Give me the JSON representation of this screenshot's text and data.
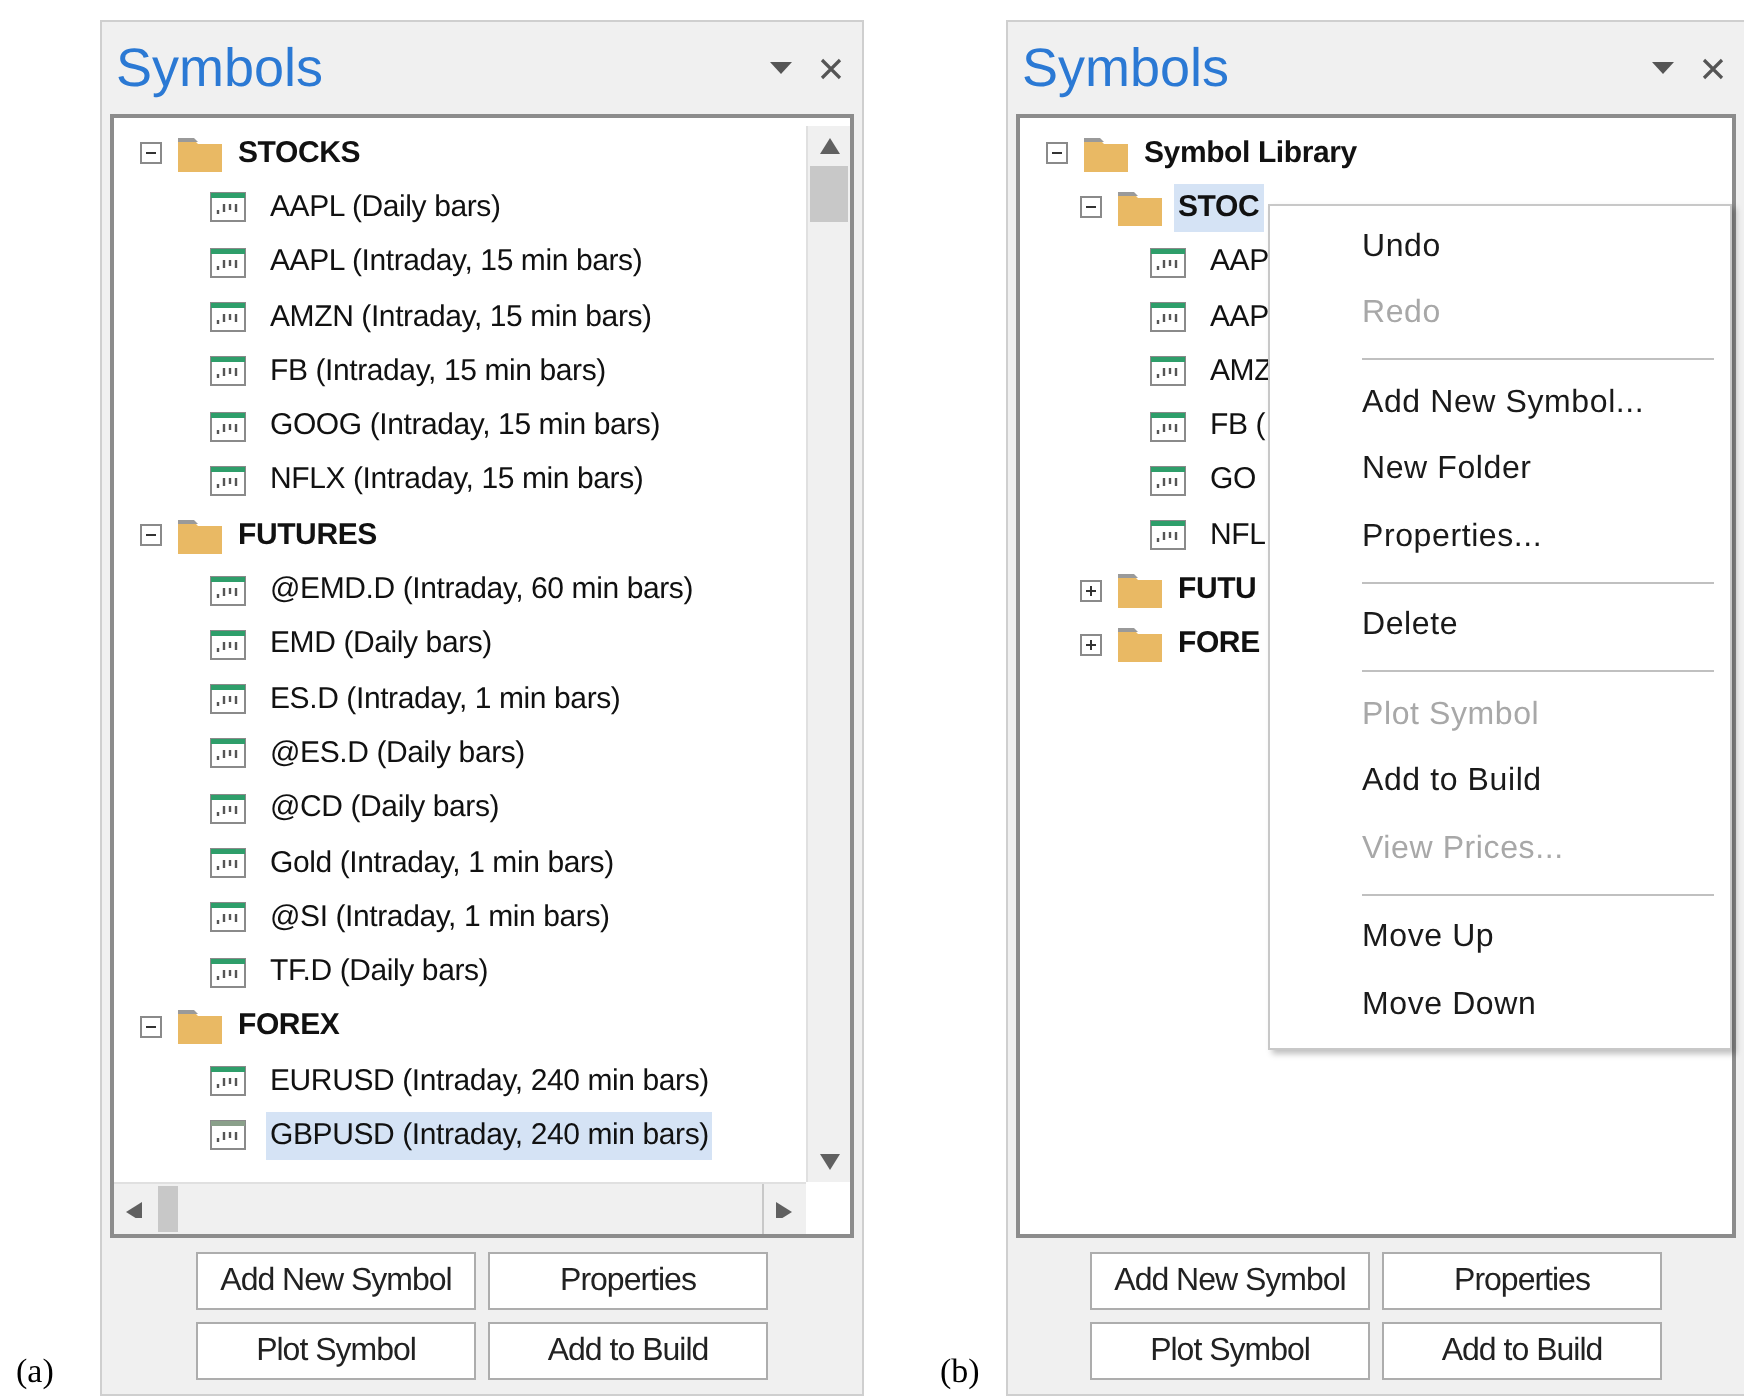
{
  "panels": [
    {
      "caption": "(a)",
      "title": "Symbols",
      "scrollbars": true,
      "tree": [
        {
          "kind": "folder",
          "label": "STOCKS",
          "expanded": true,
          "selected": false,
          "children": [
            {
              "kind": "symbol",
              "label": "AAPL (Daily bars)",
              "selected": false
            },
            {
              "kind": "symbol",
              "label": "AAPL (Intraday, 15 min bars)",
              "selected": false
            },
            {
              "kind": "symbol",
              "label": "AMZN (Intraday, 15 min bars)",
              "selected": false
            },
            {
              "kind": "symbol",
              "label": "FB (Intraday, 15 min bars)",
              "selected": false
            },
            {
              "kind": "symbol",
              "label": "GOOG (Intraday, 15 min bars)",
              "selected": false
            },
            {
              "kind": "symbol",
              "label": "NFLX (Intraday, 15 min bars)",
              "selected": false
            }
          ]
        },
        {
          "kind": "folder",
          "label": "FUTURES",
          "expanded": true,
          "selected": false,
          "children": [
            {
              "kind": "symbol",
              "label": "@EMD.D (Intraday, 60 min bars)",
              "selected": false
            },
            {
              "kind": "symbol",
              "label": "EMD (Daily bars)",
              "selected": false
            },
            {
              "kind": "symbol",
              "label": "ES.D (Intraday, 1 min bars)",
              "selected": false
            },
            {
              "kind": "symbol",
              "label": "@ES.D (Daily bars)",
              "selected": false
            },
            {
              "kind": "symbol",
              "label": "@CD (Daily bars)",
              "selected": false
            },
            {
              "kind": "symbol",
              "label": "Gold (Intraday, 1 min bars)",
              "selected": false
            },
            {
              "kind": "symbol",
              "label": "@SI (Intraday, 1 min bars)",
              "selected": false
            },
            {
              "kind": "symbol",
              "label": "TF.D (Daily bars)",
              "selected": false
            }
          ]
        },
        {
          "kind": "folder",
          "label": "FOREX",
          "expanded": true,
          "selected": false,
          "children": [
            {
              "kind": "symbol",
              "label": "EURUSD (Intraday, 240 min bars)",
              "selected": false
            },
            {
              "kind": "symbol",
              "label": "GBPUSD (Intraday, 240 min bars)",
              "selected": true
            }
          ]
        }
      ],
      "buttons": [
        "Add New Symbol",
        "Properties",
        "Plot Symbol",
        "Add to Build"
      ]
    },
    {
      "caption": "(b)",
      "title": "Symbols",
      "scrollbars": false,
      "tree": [
        {
          "kind": "folder",
          "label": "Symbol Library",
          "expanded": true,
          "selected": false,
          "children": [
            {
              "kind": "folder",
              "label": "STOC",
              "expanded": true,
              "selected": true,
              "children": [
                {
                  "kind": "symbol",
                  "label": "AAP",
                  "selected": false
                },
                {
                  "kind": "symbol",
                  "label": "AAP",
                  "selected": false
                },
                {
                  "kind": "symbol",
                  "label": "AMZ",
                  "selected": false
                },
                {
                  "kind": "symbol",
                  "label": "FB (",
                  "selected": false
                },
                {
                  "kind": "symbol",
                  "label": "GO",
                  "selected": false
                },
                {
                  "kind": "symbol",
                  "label": "NFL",
                  "selected": false
                }
              ]
            },
            {
              "kind": "folder",
              "label": "FUTU",
              "expanded": false,
              "selected": false
            },
            {
              "kind": "folder",
              "label": "FORE",
              "expanded": false,
              "selected": false
            }
          ]
        }
      ],
      "context_menu": {
        "items": [
          {
            "kind": "item",
            "label": "Undo",
            "disabled": false
          },
          {
            "kind": "item",
            "label": "Redo",
            "disabled": true
          },
          {
            "kind": "separator"
          },
          {
            "kind": "item",
            "label": "Add New Symbol...",
            "disabled": false
          },
          {
            "kind": "item",
            "label": "New Folder",
            "disabled": false
          },
          {
            "kind": "item",
            "label": "Properties...",
            "disabled": false
          },
          {
            "kind": "separator"
          },
          {
            "kind": "item",
            "label": "Delete",
            "disabled": false
          },
          {
            "kind": "separator"
          },
          {
            "kind": "item",
            "label": "Plot Symbol",
            "disabled": true
          },
          {
            "kind": "item",
            "label": "Add to Build",
            "disabled": false
          },
          {
            "kind": "item",
            "label": "View Prices...",
            "disabled": true
          },
          {
            "kind": "separator"
          },
          {
            "kind": "item",
            "label": "Move Up",
            "disabled": false
          },
          {
            "kind": "item",
            "label": "Move Down",
            "disabled": false
          }
        ]
      },
      "buttons": [
        "Add New Symbol",
        "Properties",
        "Plot Symbol",
        "Add to Build"
      ]
    }
  ]
}
